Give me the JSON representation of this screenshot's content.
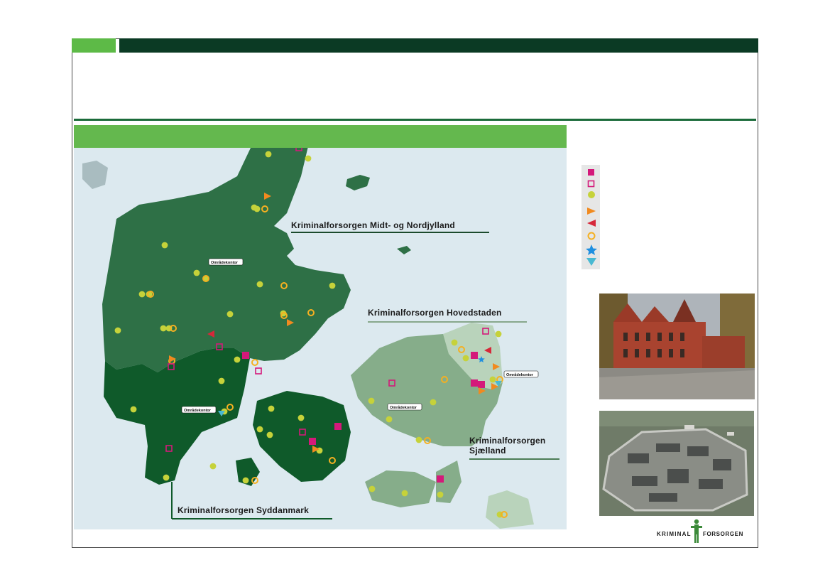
{
  "map": {
    "regions": {
      "midt_nord": "Kriminalforsorgen Midt- og Nordjylland",
      "hovedstaden": "Kriminalforsorgen Hovedstaden",
      "sjaelland_line1": "Kriminalforsorgen",
      "sjaelland_line2": "Sjælland",
      "syddanmark": "Kriminalforsorgen Syddanmark"
    },
    "office_label": "Områdekontor",
    "colors": {
      "sea": "#dce9ef",
      "midt_nord_land": "#2e7046",
      "syddanmark_land": "#0f5a2a",
      "sjaelland_land": "#86ad8a",
      "hovedstaden_land": "#b9d3bb",
      "institution_yellow_green": "#c6d23a",
      "magenta": "#d4197a",
      "orange": "#f18a1f",
      "red": "#d6283a",
      "blue": "#1f8fe0",
      "cyan": "#49b9d2"
    }
  },
  "legend": {
    "items": [
      {
        "icon": "filled-square-icon",
        "color": "#d4197a"
      },
      {
        "icon": "outline-square-icon",
        "color": "#d4197a"
      },
      {
        "icon": "filled-circle-icon",
        "color": "#c6d23a"
      },
      {
        "icon": "triangle-right-icon",
        "color": "#f18a1f"
      },
      {
        "icon": "triangle-left-icon",
        "color": "#d6283a"
      },
      {
        "icon": "ring-icon",
        "color": "#f5b021"
      },
      {
        "icon": "star-icon",
        "color": "#1f8fe0"
      },
      {
        "icon": "triangle-down-icon",
        "color": "#49b9d2"
      }
    ]
  },
  "logo": {
    "left_text": "KRIMINAL",
    "right_text": "FORSORGEN"
  }
}
